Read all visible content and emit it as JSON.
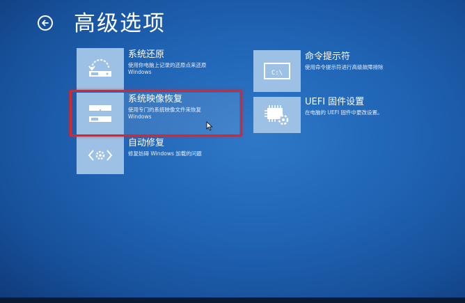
{
  "page": {
    "title": "高级选项"
  },
  "options": [
    {
      "title": "系统还原",
      "desc1": "使用你电脑上记录的还原点来还原",
      "desc2": "Windows",
      "icon": "system-restore-icon"
    },
    {
      "title": "命令提示符",
      "desc1": "使用命令提示符进行高级故障排除",
      "desc2": "",
      "icon": "command-prompt-icon"
    },
    {
      "title": "系统映像恢复",
      "desc1": "使用专门的系统映像文件来恢复",
      "desc2": "Windows",
      "icon": "system-image-icon"
    },
    {
      "title": "UEFI 固件设置",
      "desc1": "在电脑的 UEFI 固件中更改设置。",
      "desc2": "",
      "icon": "uefi-chip-icon"
    },
    {
      "title": "自动修复",
      "desc1": "修复妨碍 Windows 加载的问题",
      "desc2": "",
      "icon": "startup-repair-icon"
    }
  ],
  "colors": {
    "tile": "#9dc1e4",
    "selection": "#d8262d",
    "background": "#1f63b3"
  }
}
